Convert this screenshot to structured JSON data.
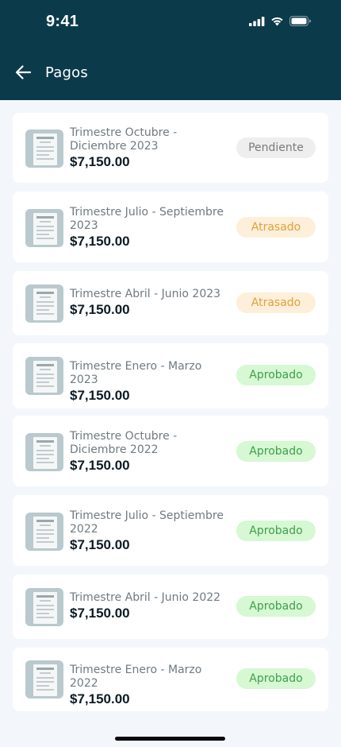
{
  "status_bar": {
    "time": "9:41"
  },
  "header": {
    "title": "Pagos",
    "back_icon": "arrow-left-icon"
  },
  "payments": [
    {
      "period": "Trimestre Octubre - Diciembre 2023",
      "amount": "$7,150.00",
      "status": "Pendiente",
      "status_kind": "pendiente"
    },
    {
      "period": "Trimestre Julio - Septiembre 2023",
      "amount": "$7,150.00",
      "status": "Atrasado",
      "status_kind": "atrasado"
    },
    {
      "period": "Trimestre Abril - Junio 2023",
      "amount": "$7,150.00",
      "status": "Atrasado",
      "status_kind": "atrasado"
    },
    {
      "period": "Trimestre Enero - Marzo 2023",
      "amount": "$7,150.00",
      "status": "Aprobado",
      "status_kind": "aprobado"
    },
    {
      "period": "Trimestre Octubre - Diciembre 2022",
      "amount": "$7,150.00",
      "status": "Aprobado",
      "status_kind": "aprobado"
    },
    {
      "period": "Trimestre Julio - Septiembre 2022",
      "amount": "$7,150.00",
      "status": "Aprobado",
      "status_kind": "aprobado"
    },
    {
      "period": "Trimestre Abril - Junio 2022",
      "amount": "$7,150.00",
      "status": "Aprobado",
      "status_kind": "aprobado"
    },
    {
      "period": "Trimestre Enero - Marzo 2022",
      "amount": "$7,150.00",
      "status": "Aprobado",
      "status_kind": "aprobado"
    }
  ],
  "colors": {
    "header_bg": "#0b3a4b",
    "pendiente": "#7a7a7a",
    "atrasado": "#e0a13d",
    "aprobado": "#3fa04a"
  }
}
